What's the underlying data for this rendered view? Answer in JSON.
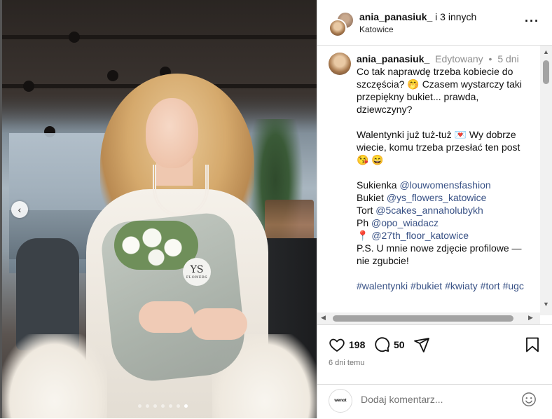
{
  "header": {
    "username": "ania_panasiuk_",
    "coauthors": "i 3 innych",
    "location": "Katowice",
    "more_icon": "more-horizontal-icon"
  },
  "caption": {
    "username": "ania_panasiuk_",
    "edited": "Edytowany",
    "dot": "•",
    "age": "5 dni",
    "line1": "Co tak naprawdę trzeba kobiecie do szczęścia?",
    "line1_emoji": "🤭",
    "line1_rest": "Czasem wystarczy taki przepiękny bukiet... prawda, dziewczyny?",
    "line2": "Walentynki już tuż-tuż",
    "line2_emoji": "💌",
    "line2_rest": "Wy dobrze wiecie, komu trzeba przesłać ten post",
    "line2_emoji_end1": "😘",
    "line2_emoji_end2": "😄",
    "dress_label": "Sukienka",
    "dress_tag": "@louwomensfashion",
    "bouquet_label": "Bukiet",
    "bouquet_tag": "@ys_flowers_katowice",
    "cake_label": "Tort",
    "cake_tag": "@5cakes_annaholubykh",
    "photo_label": "Ph",
    "photo_tag": "@opo_wiadacz",
    "pin_emoji": "📍",
    "place_tag": "@27th_floor_katowice",
    "ps": "P.S. U mnie nowe zdjęcie profilowe — nie zgubcie!",
    "hashtags": [
      "#walentynki",
      "#bukiet",
      "#kwiaty",
      "#tort",
      "#ugc"
    ]
  },
  "media": {
    "brand_logo": "YS",
    "brand_sub": "FLOWERS",
    "carousel_count": 7,
    "carousel_active": 7
  },
  "actions": {
    "likes": "198",
    "comments": "50",
    "posted": "6 dni temu"
  },
  "add_comment": {
    "avatar_text": "wenot",
    "placeholder": "Dodaj komentarz..."
  },
  "colors": {
    "link": "#385185",
    "muted": "#8e8e8e",
    "border": "#dbdbdb"
  }
}
